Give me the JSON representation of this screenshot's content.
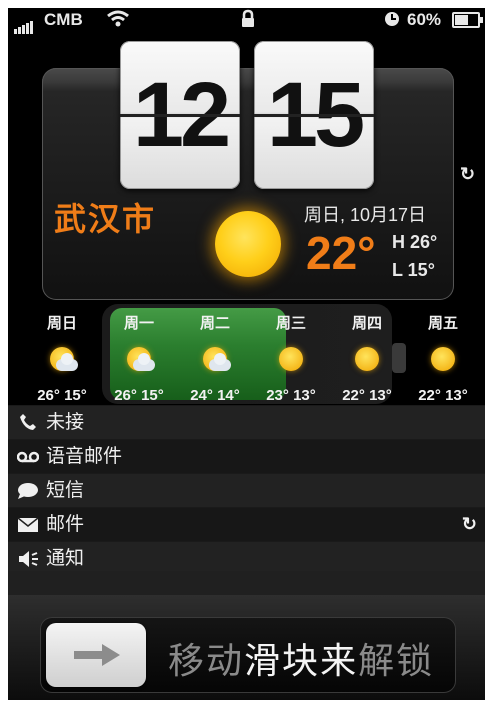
{
  "status_bar": {
    "carrier": "CMB",
    "battery_percent": "60%",
    "battery_level": 0.6,
    "icons": [
      "signal-icon",
      "wifi-icon",
      "lock-icon",
      "alarm-clock-icon",
      "battery-charging-icon"
    ]
  },
  "clock": {
    "hour": "12",
    "minute": "15"
  },
  "weather": {
    "city": "武汉市",
    "date": "周日, 10月17日",
    "temperature": "22°",
    "high": "H 26°",
    "low": "L 15°",
    "condition_icon": "sun-icon"
  },
  "forecast": [
    {
      "day": "周日",
      "temps": "26° 15°",
      "icon": "partly-cloudy-icon"
    },
    {
      "day": "周一",
      "temps": "26° 15°",
      "icon": "partly-cloudy-icon"
    },
    {
      "day": "周二",
      "temps": "24° 14°",
      "icon": "partly-cloudy-icon"
    },
    {
      "day": "周三",
      "temps": "23° 13°",
      "icon": "sun-icon"
    },
    {
      "day": "周四",
      "temps": "22° 13°",
      "icon": "sun-icon"
    },
    {
      "day": "周五",
      "temps": "22° 13°",
      "icon": "sun-icon"
    }
  ],
  "notifications": [
    {
      "label": "未接",
      "icon": "phone-icon"
    },
    {
      "label": "语音邮件",
      "icon": "voicemail-icon"
    },
    {
      "label": "短信",
      "icon": "message-bubble-icon"
    },
    {
      "label": "邮件",
      "icon": "envelope-icon"
    },
    {
      "label": "通知",
      "icon": "speaker-icon"
    }
  ],
  "slider": {
    "text": "移动滑块来解锁",
    "knob_icon": "arrow-right-icon"
  },
  "colors": {
    "accent": "#f07d18",
    "battery_green": "#2d8a31"
  }
}
